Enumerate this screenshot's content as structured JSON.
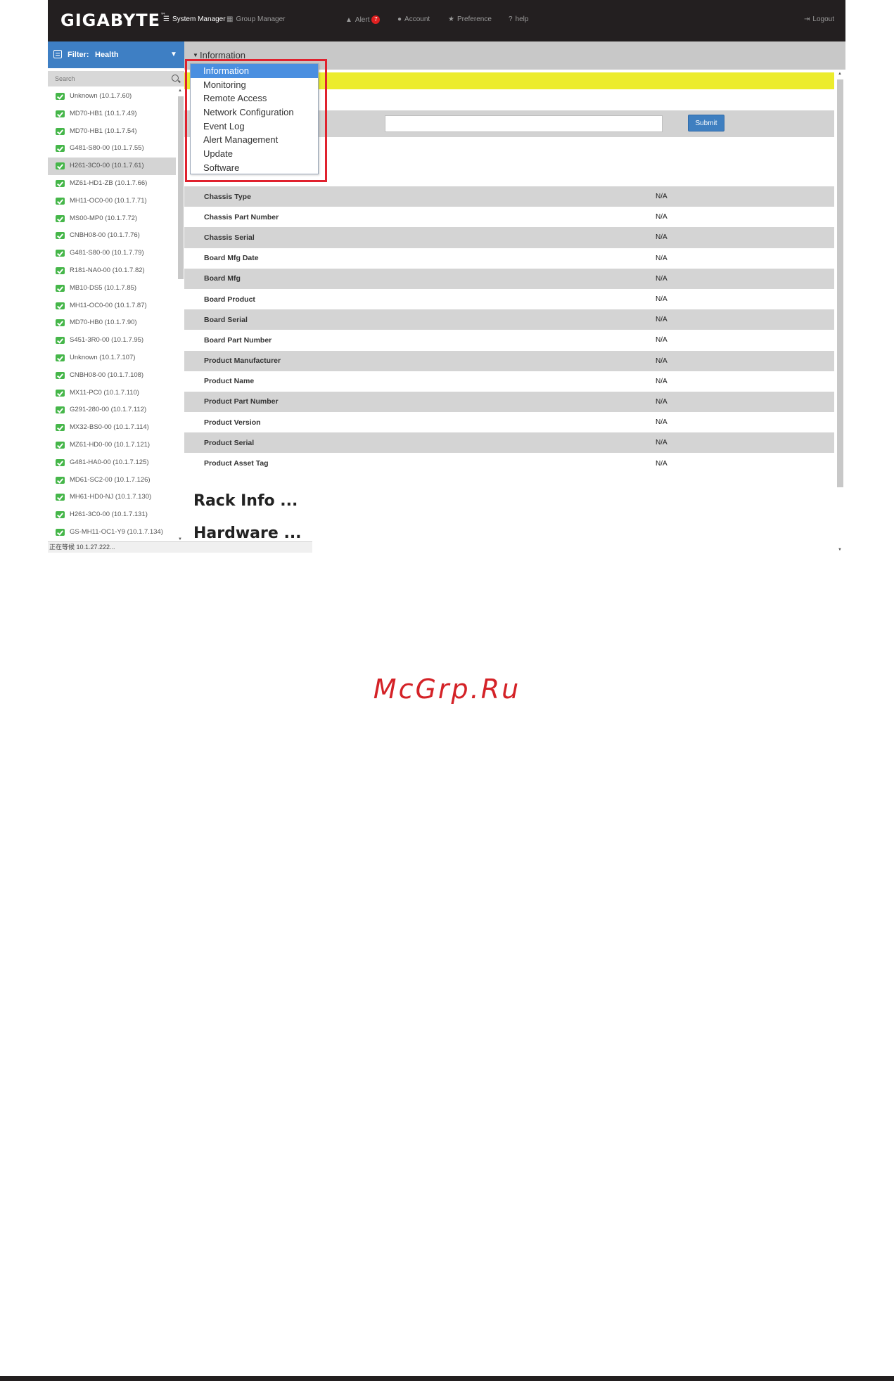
{
  "app": {
    "logo": "GIGABYTE",
    "logo_mark": "™",
    "nav": [
      {
        "label": "System Manager",
        "icon": "list-icon",
        "glyph": "☰",
        "active": true
      },
      {
        "label": "Group Manager",
        "icon": "grid-icon",
        "glyph": "▦",
        "active": false
      },
      {
        "label": "Alert",
        "icon": "warning-icon",
        "glyph": "▲",
        "active": false,
        "badge": "7"
      },
      {
        "label": "Account",
        "icon": "user-icon",
        "glyph": "●",
        "active": false
      },
      {
        "label": "Preference",
        "icon": "star-icon",
        "glyph": "★",
        "active": false
      },
      {
        "label": "help",
        "icon": "question-icon",
        "glyph": "?",
        "active": false
      }
    ],
    "logout": {
      "label": "Logout",
      "glyph": "⇥"
    }
  },
  "sidebar": {
    "filter_label": "Filter:",
    "filter_value": "Health",
    "filter_caret": "▼",
    "search_placeholder": "Search",
    "hosts": [
      "Unknown (10.1.7.60)",
      "MD70-HB1 (10.1.7.49)",
      "MD70-HB1 (10.1.7.54)",
      "G481-S80-00 (10.1.7.55)",
      "H261-3C0-00 (10.1.7.61)",
      "MZ61-HD1-ZB (10.1.7.66)",
      "MH11-OC0-00 (10.1.7.71)",
      "MS00-MP0 (10.1.7.72)",
      "CNBH08-00 (10.1.7.76)",
      "G481-S80-00 (10.1.7.79)",
      "R181-NA0-00 (10.1.7.82)",
      "MB10-DS5 (10.1.7.85)",
      "MH11-OC0-00 (10.1.7.87)",
      "MD70-HB0 (10.1.7.90)",
      "S451-3R0-00 (10.1.7.95)",
      "Unknown (10.1.7.107)",
      "CNBH08-00 (10.1.7.108)",
      "MX11-PC0 (10.1.7.110)",
      "G291-280-00 (10.1.7.112)",
      "MX32-BS0-00 (10.1.7.114)",
      "MZ61-HD0-00 (10.1.7.121)",
      "G481-HA0-00 (10.1.7.125)",
      "MD61-SC2-00 (10.1.7.126)",
      "MH61-HD0-NJ (10.1.7.130)",
      "H261-3C0-00 (10.1.7.131)",
      "GS-MH11-OC1-Y9 (10.1.7.134)"
    ],
    "selected_index": 4
  },
  "statusbar": {
    "text": "正在等候 10.1.27.222..."
  },
  "main": {
    "header_arrow": "▼",
    "header_title": "Information",
    "submit_label": "Submit",
    "fields": [
      {
        "name": "Chassis Type",
        "value": "N/A"
      },
      {
        "name": "Chassis Part Number",
        "value": "N/A"
      },
      {
        "name": "Chassis Serial",
        "value": "N/A"
      },
      {
        "name": "Board Mfg Date",
        "value": "N/A"
      },
      {
        "name": "Board Mfg",
        "value": "N/A"
      },
      {
        "name": "Board Product",
        "value": "N/A"
      },
      {
        "name": "Board Serial",
        "value": "N/A"
      },
      {
        "name": "Board Part Number",
        "value": "N/A"
      },
      {
        "name": "Product Manufacturer",
        "value": "N/A"
      },
      {
        "name": "Product Name",
        "value": "N/A"
      },
      {
        "name": "Product Part Number",
        "value": "N/A"
      },
      {
        "name": "Product Version",
        "value": "N/A"
      },
      {
        "name": "Product Serial",
        "value": "N/A"
      },
      {
        "name": "Product Asset Tag",
        "value": "N/A"
      }
    ],
    "sections": [
      "Rack Info ...",
      "Hardware ..."
    ]
  },
  "dropdown": {
    "items": [
      "Information",
      "Monitoring",
      "Remote Access",
      "Network Configuration",
      "Event Log",
      "Alert Management",
      "Update",
      "Software"
    ],
    "highlighted_index": 0
  },
  "watermark": "McGrp.Ru",
  "colors": {
    "topbar": "#231f20",
    "filter_bar": "#3e7fc4",
    "menu_highlight": "#4a8fe0",
    "callout_border": "#e0222e",
    "status_ok": "#45b649",
    "alert_banner": "#ecec2d",
    "watermark": "#d42227"
  }
}
